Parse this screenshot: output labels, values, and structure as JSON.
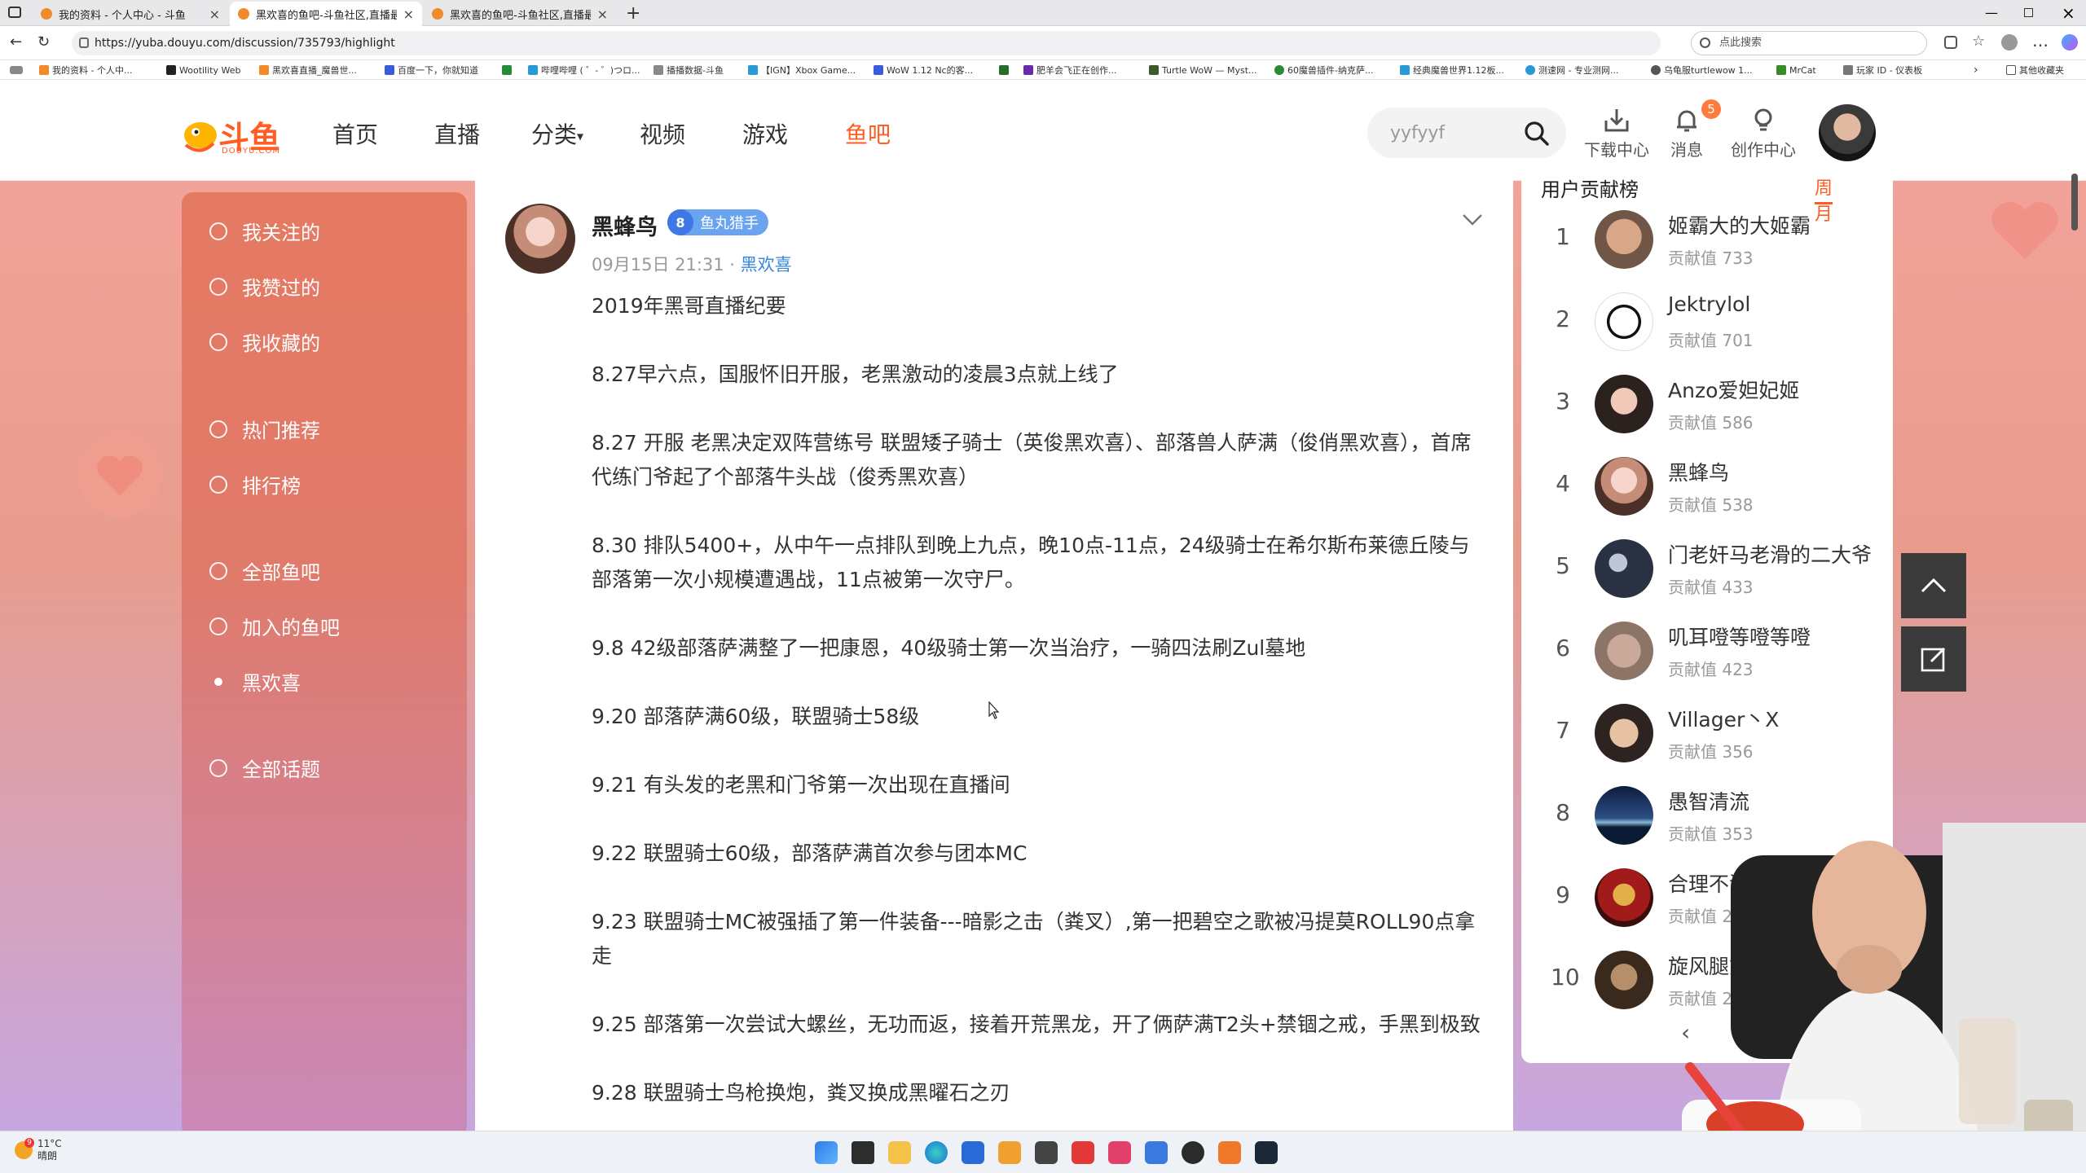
{
  "browser": {
    "tabs": [
      {
        "title": "我的资料 - 个人中心 - 斗鱼",
        "active": false
      },
      {
        "title": "黑欢喜的鱼吧-斗鱼社区,直播最好",
        "active": true
      },
      {
        "title": "黑欢喜的鱼吧-斗鱼社区,直播最好",
        "active": false
      }
    ],
    "url": "https://yuba.douyu.com/discussion/735793/highlight",
    "search_placeholder": "点此搜索",
    "bookmarks": [
      "我的资料 - 个人中...",
      "Wootility Web",
      "黑欢喜直播_魔兽世...",
      "百度一下，你就知道",
      "",
      "哔哩哔哩 ( ゜- ゜)つロ...",
      "播播数据-斗鱼",
      "【IGN】Xbox Game...",
      "WoW 1.12 Nc的客...",
      "",
      "肥羊会飞正在创作...",
      "Turtle WoW — Myst...",
      "60魔兽插件-纳克萨...",
      "经典魔兽世界1.12板...",
      "测速网 - 专业测网...",
      "乌龟服turtlewow 1...",
      "MrCat",
      "玩家 ID - 仪表板"
    ],
    "other_bookmarks": "其他收藏夹"
  },
  "header": {
    "logo_text": "斗鱼",
    "logo_sub": "DOUYU.COM",
    "nav": [
      {
        "label": "首页",
        "active": false
      },
      {
        "label": "直播",
        "active": false
      },
      {
        "label": "分类",
        "active": false,
        "caret": "▾"
      },
      {
        "label": "视频",
        "active": false
      },
      {
        "label": "游戏",
        "active": false
      },
      {
        "label": "鱼吧",
        "active": true
      }
    ],
    "search_value": "yyfyyf",
    "icons": [
      {
        "label": "下载中心",
        "icon": "download-icon"
      },
      {
        "label": "消息",
        "icon": "bell-icon",
        "badge": "5"
      },
      {
        "label": "创作中心",
        "icon": "bulb-icon"
      }
    ]
  },
  "sidebar": {
    "groups": [
      [
        {
          "label": "我关注的",
          "icon": "star-icon"
        },
        {
          "label": "我赞过的",
          "icon": "thumb-icon"
        },
        {
          "label": "我收藏的",
          "icon": "star-icon"
        }
      ],
      [
        {
          "label": "热门推荐",
          "icon": "fire-icon"
        },
        {
          "label": "排行榜",
          "icon": "trophy-icon"
        }
      ],
      [
        {
          "label": "全部鱼吧",
          "icon": "home-icon"
        },
        {
          "label": "加入的鱼吧",
          "icon": "bookmark-icon"
        },
        {
          "label": "黑欢喜",
          "icon": "dot-icon"
        }
      ],
      [
        {
          "label": "全部话题",
          "icon": "hash-icon"
        }
      ]
    ]
  },
  "post": {
    "author": "黑蜂鸟",
    "level": "8",
    "badge": "鱼丸猎手",
    "datetime": "09月15日 21:31 · ",
    "group_link": "黑欢喜",
    "paragraphs": [
      "2019年黑哥直播纪要",
      "8.27早六点，国服怀旧开服，老黑激动的凌晨3点就上线了",
      "8.27 开服 老黑决定双阵营练号 联盟矮子骑士（英俊黑欢喜）、部落兽人萨满（俊俏黑欢喜），首席代练门爷起了个部落牛头战（俊秀黑欢喜）",
      "8.30 排队5400+，从中午一点排队到晚上九点，晚10点-11点，24级骑士在希尔斯布莱德丘陵与部落第一次小规模遭遇战，11点被第一次守尸。",
      "9.8  42级部落萨满整了一把康恩，40级骑士第一次当治疗，一骑四法刷Zul墓地",
      "9.20 部落萨满60级，联盟骑士58级",
      "9.21 有头发的老黑和门爷第一次出现在直播间",
      "9.22 联盟骑士60级，部落萨满首次参与团本MC",
      "9.23 联盟骑士MC被强插了第一件装备---暗影之击（粪叉）,第一把碧空之歌被冯提莫ROLL90点拿走",
      "9.25 部落第一次尝试大螺丝，无功而返，接着开荒黑龙，开了俩萨满T2头+禁锢之戒，手黑到极致",
      "9.28 联盟骑士鸟枪换炮，粪叉换成黑曜石之刃"
    ]
  },
  "ranking": {
    "title": "用户贡献榜",
    "tabs": [
      "周",
      "月"
    ],
    "score_label": "贡献值",
    "rows": [
      {
        "rank": "1",
        "name": "姬霸大的大姬霸",
        "score": "733"
      },
      {
        "rank": "2",
        "name": "Jektrylol",
        "score": "701"
      },
      {
        "rank": "3",
        "name": "Anzo爱妲妃姬",
        "score": "586"
      },
      {
        "rank": "4",
        "name": "黑蜂鸟",
        "score": "538"
      },
      {
        "rank": "5",
        "name": "门老奸马老滑的二大爷",
        "score": "433"
      },
      {
        "rank": "6",
        "name": "叽耳噔等噔等噔",
        "score": "423"
      },
      {
        "rank": "7",
        "name": "Villager丶X",
        "score": "356"
      },
      {
        "rank": "8",
        "name": "愚智清流",
        "score": "353"
      },
      {
        "rank": "9",
        "name": "合理不没毛",
        "score": "278"
      },
      {
        "rank": "10",
        "name": "旋风腿式",
        "score": "2"
      }
    ],
    "prev_arrow": "‹"
  },
  "taskbar": {
    "weather_temp": "11°C",
    "weather_desc": "晴朗",
    "weather_badge": "9"
  },
  "colors": {
    "accent": "#ff5d23",
    "link": "#3a86d8",
    "badge_blue": "#6aa4f0"
  }
}
